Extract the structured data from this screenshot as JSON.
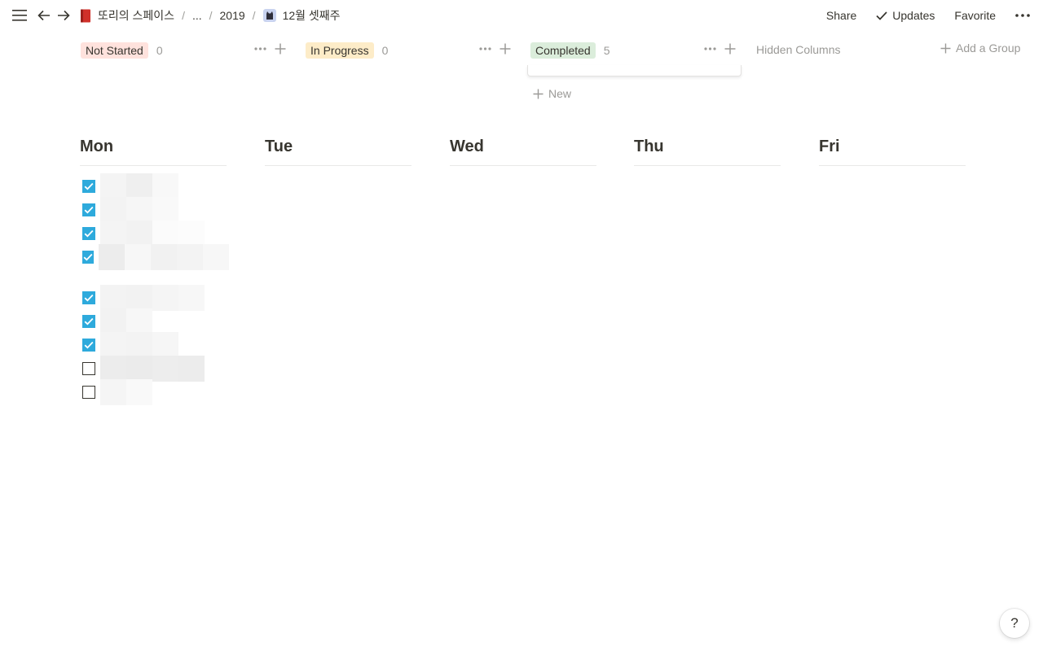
{
  "breadcrumb": {
    "workspace": "또리의 스페이스",
    "ellipsis": "...",
    "year": "2019",
    "page": "12월 셋째주"
  },
  "actions": {
    "share": "Share",
    "updates": "Updates",
    "favorite": "Favorite"
  },
  "board": {
    "groups": [
      {
        "label": "Not Started",
        "count": "0",
        "bg": "#ffe2dd"
      },
      {
        "label": "In Progress",
        "count": "0",
        "bg": "#fdecc8"
      },
      {
        "label": "Completed",
        "count": "5",
        "bg": "#dbeddb"
      }
    ],
    "hidden_columns": "Hidden Columns",
    "add_group": "Add a Group",
    "new": "New"
  },
  "days": [
    "Mon",
    "Tue",
    "Wed",
    "Thu",
    "Fri"
  ],
  "todos": [
    {
      "checked": true
    },
    {
      "checked": true
    },
    {
      "checked": true
    },
    {
      "checked": true
    },
    {
      "checked": true
    },
    {
      "checked": true
    },
    {
      "checked": true
    },
    {
      "checked": false
    },
    {
      "checked": false
    }
  ],
  "help": "?",
  "colors": {
    "accent": "#2eaadc",
    "text": "#37352f",
    "muted": "#9b9a97"
  }
}
